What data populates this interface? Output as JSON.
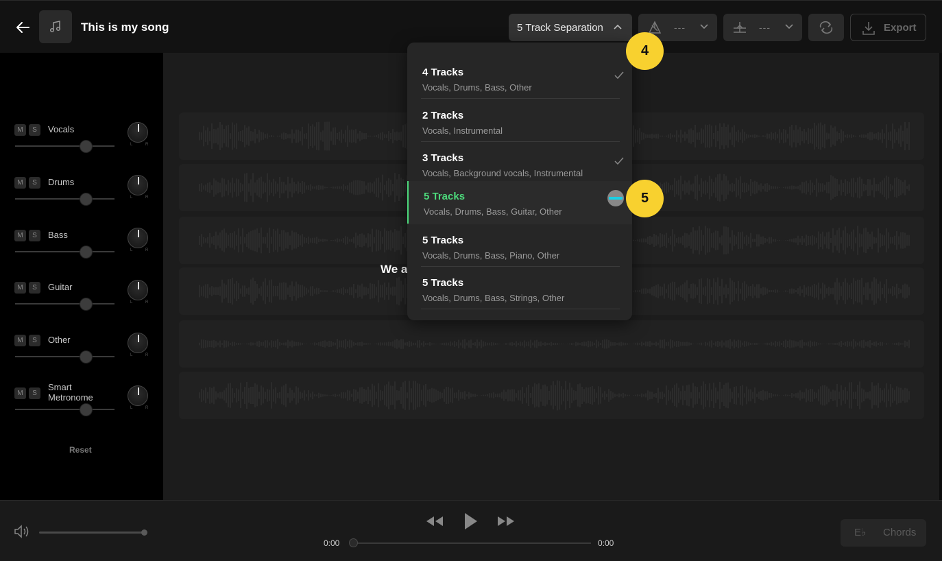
{
  "header": {
    "song_title": "This is my song",
    "separation_label": "5 Track Separation",
    "pitch_value": "---",
    "tempo_value": "---",
    "export_label": "Export"
  },
  "mixer": {
    "tracks": [
      {
        "name": "Vocals",
        "mute": "M",
        "solo": "S",
        "pan_l": "L",
        "pan_r": "R"
      },
      {
        "name": "Drums",
        "mute": "M",
        "solo": "S",
        "pan_l": "L",
        "pan_r": "R"
      },
      {
        "name": "Bass",
        "mute": "M",
        "solo": "S",
        "pan_l": "L",
        "pan_r": "R"
      },
      {
        "name": "Guitar",
        "mute": "M",
        "solo": "S",
        "pan_l": "L",
        "pan_r": "R"
      },
      {
        "name": "Other",
        "mute": "M",
        "solo": "S",
        "pan_l": "L",
        "pan_r": "R"
      },
      {
        "name": "Smart Metronome",
        "mute": "M",
        "solo": "S",
        "pan_l": "L",
        "pan_r": "R"
      }
    ],
    "reset_label": "Reset"
  },
  "main": {
    "status_text": "We a"
  },
  "separation_menu": {
    "options": [
      {
        "title": "4 Tracks",
        "subtitle": "Vocals, Drums, Bass, Other",
        "checked": true
      },
      {
        "title": "2 Tracks",
        "subtitle": "Vocals, Instrumental",
        "checked": false
      },
      {
        "title": "3 Tracks",
        "subtitle": "Vocals, Background vocals, Instrumental",
        "checked": true
      },
      {
        "title": "5 Tracks",
        "subtitle": "Vocals, Drums, Bass, Guitar, Other",
        "checked": false,
        "active": true
      },
      {
        "title": "5 Tracks",
        "subtitle": "Vocals, Drums, Bass, Piano, Other",
        "checked": false
      },
      {
        "title": "5 Tracks",
        "subtitle": "Vocals, Drums, Bass, Strings, Other",
        "checked": false
      }
    ]
  },
  "badges": {
    "step_4": "4",
    "step_5": "5"
  },
  "transport": {
    "time_start": "0:00",
    "time_end": "0:00",
    "chords_key": "E♭",
    "chords_label": "Chords"
  },
  "colors": {
    "accent_green": "#4cd97b",
    "badge_yellow": "#f8d12f",
    "cursor_cyan": "#19d0e6"
  }
}
